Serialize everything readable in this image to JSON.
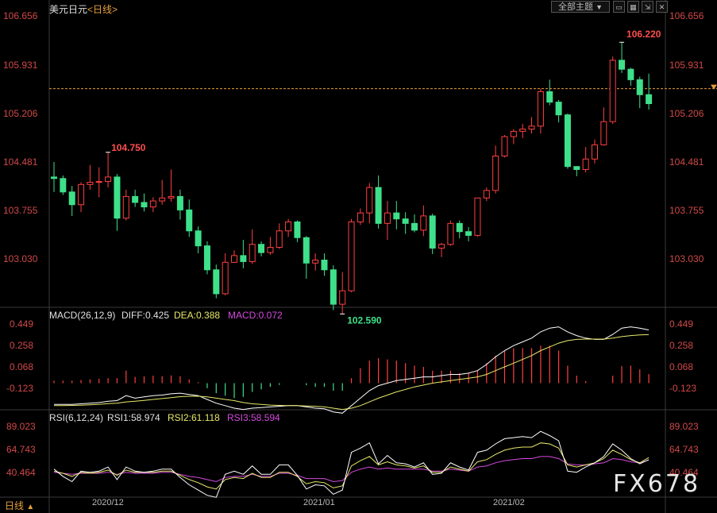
{
  "header": {
    "symbol": "美元日元",
    "period_tag": "<日线>",
    "theme_button": "全部主题",
    "dropdown_glyph": "▼"
  },
  "main_axis": {
    "ticks": [
      "106.656",
      "105.931",
      "105.206",
      "104.481",
      "103.755",
      "103.030"
    ]
  },
  "macd": {
    "title": "MACD(26,12,9)",
    "diff_label": "DIFF:0.425",
    "dea_label": "DEA:0.388",
    "macd_label": "MACD:0.072",
    "ticks": [
      "0.449",
      "0.258",
      "0.068",
      "-0.123"
    ]
  },
  "rsi": {
    "title": "RSI(6,12,24)",
    "rsi1_label": "RSI1:58.974",
    "rsi2_label": "RSI2:61.118",
    "rsi3_label": "RSI3:58.594",
    "ticks": [
      "89.023",
      "64.743",
      "40.464"
    ]
  },
  "footer": {
    "period": "日线",
    "period_glyph": "▲",
    "dates": [
      "2020/12",
      "2021/01",
      "2021/02"
    ]
  },
  "watermark": "FX678",
  "colors": {
    "up": "#ff4040",
    "down": "#3ee08a",
    "diff": "#ffffff",
    "dea": "#e8e86a",
    "macd": "#d54adf",
    "axis": "#d04848"
  },
  "chart_data": [
    {
      "type": "candlestick",
      "title": "美元日元<日线>",
      "ylim": [
        102.7,
        106.7
      ],
      "max_annotation": "106.220",
      "min_annotation": "102.590",
      "second_annotation": "104.750",
      "current_price": 105.6,
      "candles": [
        [
          104.42,
          104.4,
          104.62,
          104.22
        ],
        [
          104.4,
          104.22,
          104.44,
          104.18
        ],
        [
          104.22,
          104.05,
          104.3,
          103.9
        ],
        [
          104.05,
          104.32,
          104.35,
          103.95
        ],
        [
          104.32,
          104.35,
          104.58,
          104.25
        ],
        [
          104.35,
          104.36,
          104.55,
          104.15
        ],
        [
          104.36,
          104.42,
          104.75,
          104.28
        ],
        [
          104.42,
          103.87,
          104.46,
          103.7
        ],
        [
          103.87,
          104.16,
          104.25,
          103.84
        ],
        [
          104.16,
          104.08,
          104.25,
          104.02
        ],
        [
          104.08,
          104.02,
          104.2,
          103.96
        ],
        [
          104.02,
          104.1,
          104.15,
          103.95
        ],
        [
          104.1,
          104.14,
          104.38,
          104.05
        ],
        [
          104.14,
          104.16,
          104.52,
          104.09
        ],
        [
          104.16,
          103.98,
          104.25,
          103.85
        ],
        [
          103.98,
          103.7,
          104.12,
          103.62
        ],
        [
          103.7,
          103.5,
          103.76,
          103.4
        ],
        [
          103.5,
          103.18,
          103.56,
          103.12
        ],
        [
          103.18,
          102.86,
          103.25,
          102.8
        ],
        [
          102.86,
          103.28,
          103.4,
          102.84
        ],
        [
          103.28,
          103.37,
          103.44,
          103.27
        ],
        [
          103.37,
          103.29,
          103.58,
          103.2
        ],
        [
          103.29,
          103.52,
          103.72,
          103.26
        ],
        [
          103.52,
          103.41,
          103.56,
          103.36
        ],
        [
          103.41,
          103.48,
          103.62,
          103.38
        ],
        [
          103.48,
          103.7,
          103.8,
          103.46
        ],
        [
          103.7,
          103.82,
          103.86,
          103.62
        ],
        [
          103.82,
          103.61,
          103.84,
          103.55
        ],
        [
          103.61,
          103.27,
          103.63,
          103.06
        ],
        [
          103.27,
          103.31,
          103.4,
          103.17
        ],
        [
          103.31,
          103.18,
          103.4,
          103.1
        ],
        [
          103.18,
          102.72,
          103.24,
          102.64
        ],
        [
          102.72,
          102.9,
          103.15,
          102.59
        ],
        [
          102.9,
          103.82,
          103.86,
          102.88
        ],
        [
          103.82,
          103.94,
          104.0,
          103.78
        ],
        [
          103.94,
          104.28,
          104.34,
          103.8
        ],
        [
          104.28,
          103.8,
          104.44,
          103.73
        ],
        [
          103.8,
          103.94,
          104.1,
          103.58
        ],
        [
          103.94,
          103.86,
          104.1,
          103.72
        ],
        [
          103.86,
          103.8,
          103.95,
          103.66
        ],
        [
          103.8,
          103.71,
          103.92,
          103.68
        ],
        [
          103.71,
          103.9,
          104.04,
          103.63
        ],
        [
          103.9,
          103.47,
          103.93,
          103.39
        ],
        [
          103.47,
          103.52,
          103.54,
          103.35
        ],
        [
          103.52,
          103.8,
          103.84,
          103.5
        ],
        [
          103.8,
          103.69,
          103.84,
          103.6
        ],
        [
          103.69,
          103.64,
          103.75,
          103.56
        ],
        [
          103.64,
          104.14,
          104.14,
          103.62
        ],
        [
          104.14,
          104.24,
          104.28,
          104.1
        ],
        [
          104.24,
          104.7,
          104.84,
          104.2
        ],
        [
          104.7,
          104.96,
          104.98,
          104.68
        ],
        [
          104.96,
          105.03,
          105.06,
          104.86
        ],
        [
          105.03,
          105.06,
          105.13,
          104.94
        ],
        [
          105.06,
          105.1,
          105.22,
          105.0
        ],
        [
          105.1,
          105.56,
          105.6,
          105.0
        ],
        [
          105.56,
          105.42,
          105.72,
          105.38
        ],
        [
          105.42,
          105.25,
          105.45,
          105.15
        ],
        [
          105.25,
          104.56,
          105.27,
          104.53
        ],
        [
          104.56,
          104.52,
          104.56,
          104.43
        ],
        [
          104.52,
          104.66,
          104.82,
          104.48
        ],
        [
          104.66,
          104.85,
          104.92,
          104.6
        ],
        [
          104.85,
          105.16,
          105.35,
          104.84
        ],
        [
          105.16,
          105.98,
          106.03,
          105.13
        ],
        [
          105.98,
          105.86,
          106.22,
          105.81
        ],
        [
          105.86,
          105.72,
          105.88,
          105.64
        ],
        [
          105.72,
          105.52,
          105.76,
          105.34
        ],
        [
          105.52,
          105.4,
          105.8,
          105.32
        ]
      ]
    },
    {
      "type": "line",
      "title": "MACD(26,12,9)",
      "ylim": [
        -0.2,
        0.53
      ],
      "series": [
        {
          "name": "DIFF",
          "values": [
            -0.17,
            -0.17,
            -0.17,
            -0.165,
            -0.16,
            -0.155,
            -0.145,
            -0.14,
            -0.1,
            -0.12,
            -0.11,
            -0.1,
            -0.095,
            -0.085,
            -0.08,
            -0.09,
            -0.1,
            -0.13,
            -0.16,
            -0.18,
            -0.2,
            -0.21,
            -0.2,
            -0.195,
            -0.19,
            -0.185,
            -0.18,
            -0.18,
            -0.19,
            -0.2,
            -0.205,
            -0.23,
            -0.24,
            -0.18,
            -0.12,
            -0.06,
            -0.02,
            0.0,
            0.02,
            0.03,
            0.04,
            0.05,
            0.05,
            0.06,
            0.07,
            0.07,
            0.08,
            0.1,
            0.15,
            0.21,
            0.26,
            0.3,
            0.33,
            0.36,
            0.41,
            0.44,
            0.45,
            0.41,
            0.38,
            0.36,
            0.35,
            0.35,
            0.39,
            0.44,
            0.45,
            0.44,
            0.425
          ]
        },
        {
          "name": "DEA",
          "values": [
            -0.18,
            -0.18,
            -0.178,
            -0.176,
            -0.173,
            -0.169,
            -0.164,
            -0.16,
            -0.15,
            -0.145,
            -0.138,
            -0.13,
            -0.123,
            -0.116,
            -0.108,
            -0.105,
            -0.104,
            -0.11,
            -0.12,
            -0.13,
            -0.14,
            -0.155,
            -0.165,
            -0.17,
            -0.175,
            -0.178,
            -0.18,
            -0.18,
            -0.182,
            -0.185,
            -0.19,
            -0.2,
            -0.21,
            -0.2,
            -0.18,
            -0.15,
            -0.12,
            -0.095,
            -0.07,
            -0.05,
            -0.03,
            -0.015,
            0.0,
            0.01,
            0.02,
            0.03,
            0.04,
            0.05,
            0.07,
            0.1,
            0.13,
            0.16,
            0.19,
            0.22,
            0.26,
            0.29,
            0.32,
            0.34,
            0.35,
            0.352,
            0.352,
            0.352,
            0.36,
            0.372,
            0.38,
            0.385,
            0.388
          ]
        },
        {
          "name": "MACD",
          "values": [
            0.02,
            0.02,
            0.02,
            0.025,
            0.03,
            0.035,
            0.04,
            0.04,
            0.1,
            0.05,
            0.055,
            0.06,
            0.056,
            0.062,
            0.056,
            0.03,
            0.008,
            -0.04,
            -0.08,
            -0.1,
            -0.12,
            -0.11,
            -0.07,
            -0.05,
            -0.03,
            -0.014,
            0.0,
            0.0,
            -0.016,
            -0.03,
            -0.03,
            -0.06,
            -0.06,
            0.04,
            0.12,
            0.18,
            0.2,
            0.19,
            0.18,
            0.16,
            0.14,
            0.13,
            0.1,
            0.1,
            0.1,
            0.08,
            0.08,
            0.1,
            0.16,
            0.22,
            0.26,
            0.28,
            0.28,
            0.28,
            0.3,
            0.3,
            0.26,
            0.14,
            0.06,
            0.016,
            0.0,
            0.0,
            0.06,
            0.136,
            0.14,
            0.11,
            0.072
          ]
        }
      ]
    },
    {
      "type": "line",
      "title": "RSI(6,12,24)",
      "ylim": [
        24,
        96
      ],
      "series": [
        {
          "name": "RSI1",
          "values": [
            50,
            43,
            38,
            48,
            47,
            48,
            52,
            40,
            52,
            48,
            47,
            48,
            50,
            50,
            42,
            35,
            30,
            25,
            23,
            45,
            48,
            45,
            53,
            45,
            45,
            54,
            54,
            44,
            31,
            35,
            34,
            26,
            30,
            66,
            70,
            75,
            55,
            63,
            56,
            55,
            52,
            56,
            45,
            46,
            56,
            52,
            49,
            66,
            68,
            74,
            79,
            80,
            81,
            80,
            86,
            82,
            77,
            48,
            47,
            52,
            56,
            62,
            74,
            68,
            60,
            55,
            59
          ]
        },
        {
          "name": "RSI2",
          "values": [
            48,
            46,
            43,
            47,
            46,
            47,
            49,
            44,
            49,
            47,
            47,
            47,
            48,
            48,
            44,
            40,
            37,
            33,
            31,
            40,
            42,
            41,
            46,
            42,
            42,
            47,
            47,
            43,
            36,
            38,
            37,
            32,
            34,
            53,
            58,
            62,
            54,
            57,
            54,
            53,
            51,
            53,
            47,
            47,
            52,
            50,
            48,
            57,
            59,
            64,
            68,
            70,
            71,
            71,
            75,
            74,
            70,
            54,
            52,
            54,
            56,
            60,
            68,
            64,
            59,
            56,
            61
          ]
        },
        {
          "name": "RSI3",
          "values": [
            47,
            46,
            45,
            46,
            46,
            46,
            47,
            45,
            47,
            46,
            46,
            46,
            47,
            47,
            45,
            43,
            42,
            40,
            38,
            42,
            43,
            43,
            45,
            43,
            43,
            46,
            46,
            44,
            41,
            41,
            41,
            38,
            39,
            47,
            50,
            52,
            50,
            51,
            50,
            50,
            50,
            50,
            48,
            48,
            50,
            49,
            48,
            52,
            53,
            56,
            58,
            59,
            60,
            60,
            62,
            62,
            60,
            55,
            54,
            54,
            55,
            56,
            60,
            59,
            57,
            56,
            58.6
          ]
        }
      ]
    }
  ]
}
